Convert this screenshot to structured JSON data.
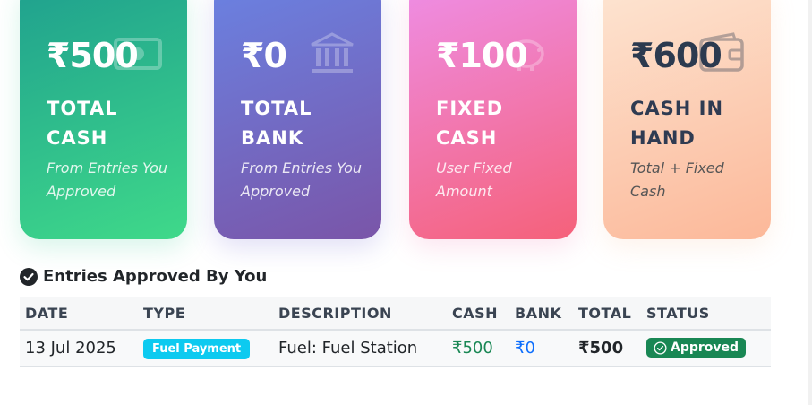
{
  "cards": [
    {
      "amount": "₹500",
      "label_line1": "TOTAL",
      "label_line2": "CASH",
      "sub": "From Entries You Approved",
      "icon": "money-bill-icon"
    },
    {
      "amount": "₹0",
      "label_line1": "TOTAL",
      "label_line2": "BANK",
      "sub": "From Entries You Approved",
      "icon": "bank-icon"
    },
    {
      "amount": "₹100",
      "label_line1": "FIXED",
      "label_line2": "CASH",
      "sub": "User Fixed Amount",
      "icon": "piggy-bank-icon"
    },
    {
      "amount": "₹600",
      "label_line1": "CASH IN",
      "label_line2": "HAND",
      "sub": "Total + Fixed Cash",
      "icon": "wallet-icon"
    }
  ],
  "section": {
    "title": "Entries Approved By You",
    "icon": "check-circle-icon"
  },
  "table": {
    "headers": [
      "DATE",
      "TYPE",
      "DESCRIPTION",
      "CASH",
      "BANK",
      "TOTAL",
      "STATUS"
    ],
    "rows": [
      {
        "date": "13 Jul 2025",
        "type": "Fuel Payment",
        "description": "Fuel: Fuel Station",
        "cash": "₹500",
        "bank": "₹0",
        "total": "₹500",
        "status": "Approved"
      }
    ]
  },
  "colors": {
    "cash": "#198754",
    "bank": "#0d6efd",
    "type_badge": "#0dcaf0",
    "status_badge": "#198754"
  }
}
